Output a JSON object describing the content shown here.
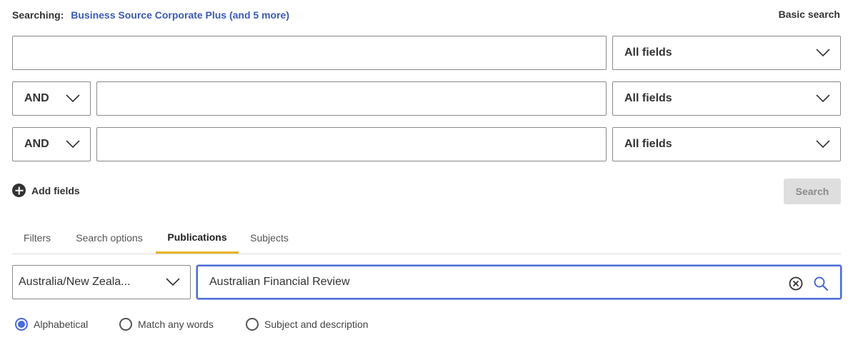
{
  "header": {
    "searching_label": "Searching:",
    "databases": "Business Source Corporate Plus (and 5 more)",
    "basic_search": "Basic search"
  },
  "rows": [
    {
      "query": "",
      "field": "All fields"
    },
    {
      "operator": "AND",
      "query": "",
      "field": "All fields"
    },
    {
      "operator": "AND",
      "query": "",
      "field": "All fields"
    }
  ],
  "add_fields": "Add fields",
  "search_button": "Search",
  "tabs": [
    "Filters",
    "Search options",
    "Publications",
    "Subjects"
  ],
  "active_tab": "Publications",
  "publications": {
    "region": "Australia/New Zeala...",
    "search_value": "Australian Financial Review",
    "options": [
      "Alphabetical",
      "Match any words",
      "Subject and description"
    ],
    "selected_option": "Alphabetical"
  },
  "icons": [
    "chevron-down-icon",
    "plus-circle-icon",
    "clear-icon",
    "search-icon"
  ],
  "colors": {
    "accent": "#4a6bd6",
    "link": "#3b5ab8",
    "tab_underline": "#e8b52b",
    "disabled_button": "#dedede"
  }
}
